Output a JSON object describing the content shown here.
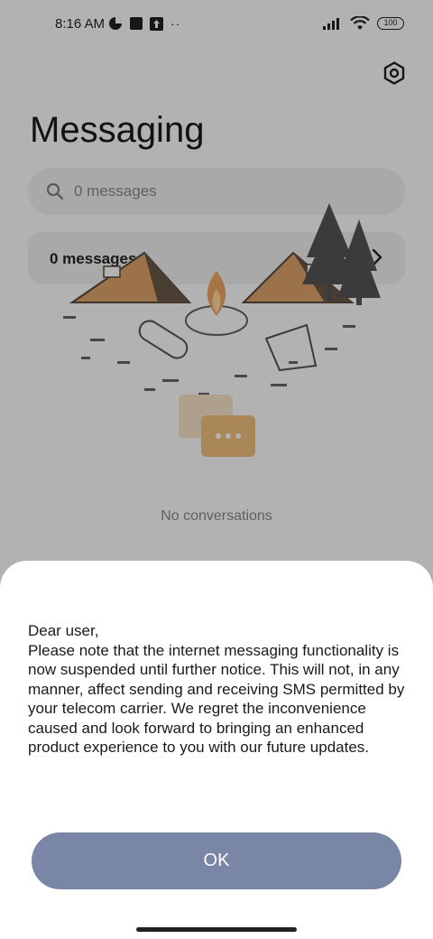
{
  "status": {
    "time": "8:16 AM",
    "battery": "100"
  },
  "header": {
    "title": "Messaging"
  },
  "search": {
    "placeholder": "0 messages"
  },
  "summary": {
    "count_label": "0 messages"
  },
  "empty_state": {
    "text": "No conversations"
  },
  "dialog": {
    "message": "Dear user,\nPlease note that the internet messaging functionality is now suspended until further notice. This will not, in any manner, affect sending and receiving SMS permitted by your telecom carrier. We regret the inconvenience caused and look forward to bringing an enhanced product experience to you with our future updates.",
    "ok_label": "OK"
  },
  "colors": {
    "ok_button": "#7a86a6",
    "scrim": "rgba(0,0,0,0.3)"
  },
  "icons": [
    "settings-gear-icon",
    "search-icon",
    "chevron-right-icon",
    "wifi-icon",
    "signal-icon",
    "battery-icon"
  ]
}
